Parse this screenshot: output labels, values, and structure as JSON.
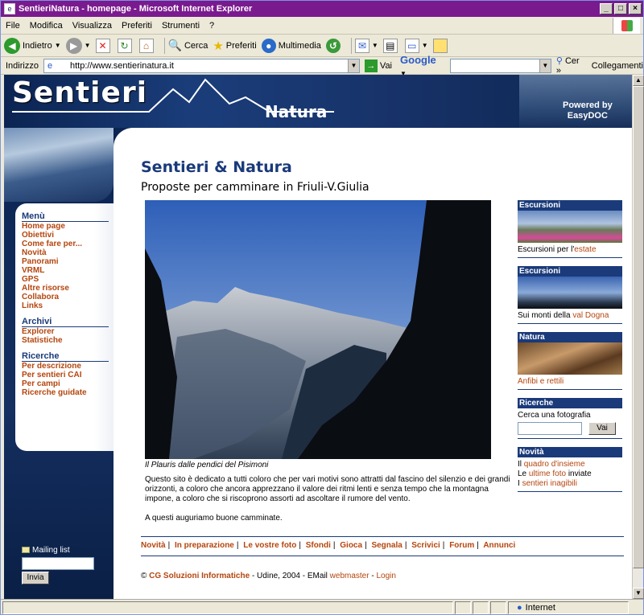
{
  "window": {
    "title": "SentieriNatura - homepage - Microsoft Internet Explorer"
  },
  "menubar": {
    "items": [
      "File",
      "Modifica",
      "Visualizza",
      "Preferiti",
      "Strumenti",
      "?"
    ]
  },
  "toolbar": {
    "back_label": "Indietro",
    "search_label": "Cerca",
    "favorites_label": "Preferiti",
    "media_label": "Multimedia"
  },
  "addressbar": {
    "label": "Indirizzo",
    "url": "http://www.sentierinatura.it",
    "go_label": "Vai",
    "google_label": "Google",
    "cerca_label": "Cer",
    "links_label": "Collegamenti"
  },
  "status": {
    "zone": "Internet"
  },
  "header": {
    "title": "Sentieri",
    "subtitle": "Natura",
    "powered": "Powered by",
    "powered_by": "EasyDOC"
  },
  "sidebar": {
    "menu_head": "Menù",
    "menu_items": [
      "Home page",
      "Obiettivi",
      "Come fare per...",
      "Novità",
      "Panorami",
      "VRML",
      "GPS",
      "Altre risorse",
      "Collabora",
      "Links"
    ],
    "archive_head": "Archivi",
    "archive_items": [
      "Explorer",
      "Statistiche"
    ],
    "search_head": "Ricerche",
    "search_items": [
      "Per descrizione",
      "Per sentieri CAI",
      "Per campi",
      "Ricerche guidate"
    ],
    "mailing_label": "Mailing list",
    "invia_label": "Invia"
  },
  "main": {
    "title": "Sentieri & Natura",
    "subtitle": "Proposte per camminare in Friuli-V.Giulia",
    "caption": "Il Plauris dalle pendici del Pisimoni",
    "para1": "Questo sito è dedicato a tutti coloro che per vari motivi sono attratti dal fascino del silenzio e dei grandi orizzonti, a coloro che ancora apprezzano il valore dei ritmi lenti e senza tempo che la montagna impone, a coloro che si riscoprono assorti ad ascoltare il rumore del vento.",
    "para2": "A questi auguriamo buone camminate."
  },
  "right": {
    "box1_head": "Escursioni",
    "box1_text": "Escursioni per l'",
    "box1_link": "estate",
    "box2_head": "Escursioni",
    "box2_text": "Sui monti della ",
    "box2_link": "val Dogna",
    "box3_head": "Natura",
    "box3_link": "Anfibi e rettili",
    "box4_head": "Ricerche",
    "box4_text": "Cerca una fotografia",
    "box4_button": "Vai",
    "box5_head": "Novità",
    "news1_pre": "Il ",
    "news1_link": "quadro d'insieme",
    "news2_pre": "Le ",
    "news2_link": "ultime foto",
    "news2_post": " inviate",
    "news3_pre": "I ",
    "news3_link": "sentieri inagibili"
  },
  "footer": {
    "nav": [
      "Novità",
      "In preparazione",
      "Le vostre foto",
      "Sfondi",
      "Gioca",
      "Segnala",
      "Scrivici",
      "Forum",
      "Annunci"
    ],
    "copy_symbol": "©",
    "brand": "CG Soluzioni Informatiche",
    "copy_text": " - Udine, 2004 - EMail ",
    "webmaster": "webmaster",
    "sep": " - ",
    "login": "Login"
  }
}
